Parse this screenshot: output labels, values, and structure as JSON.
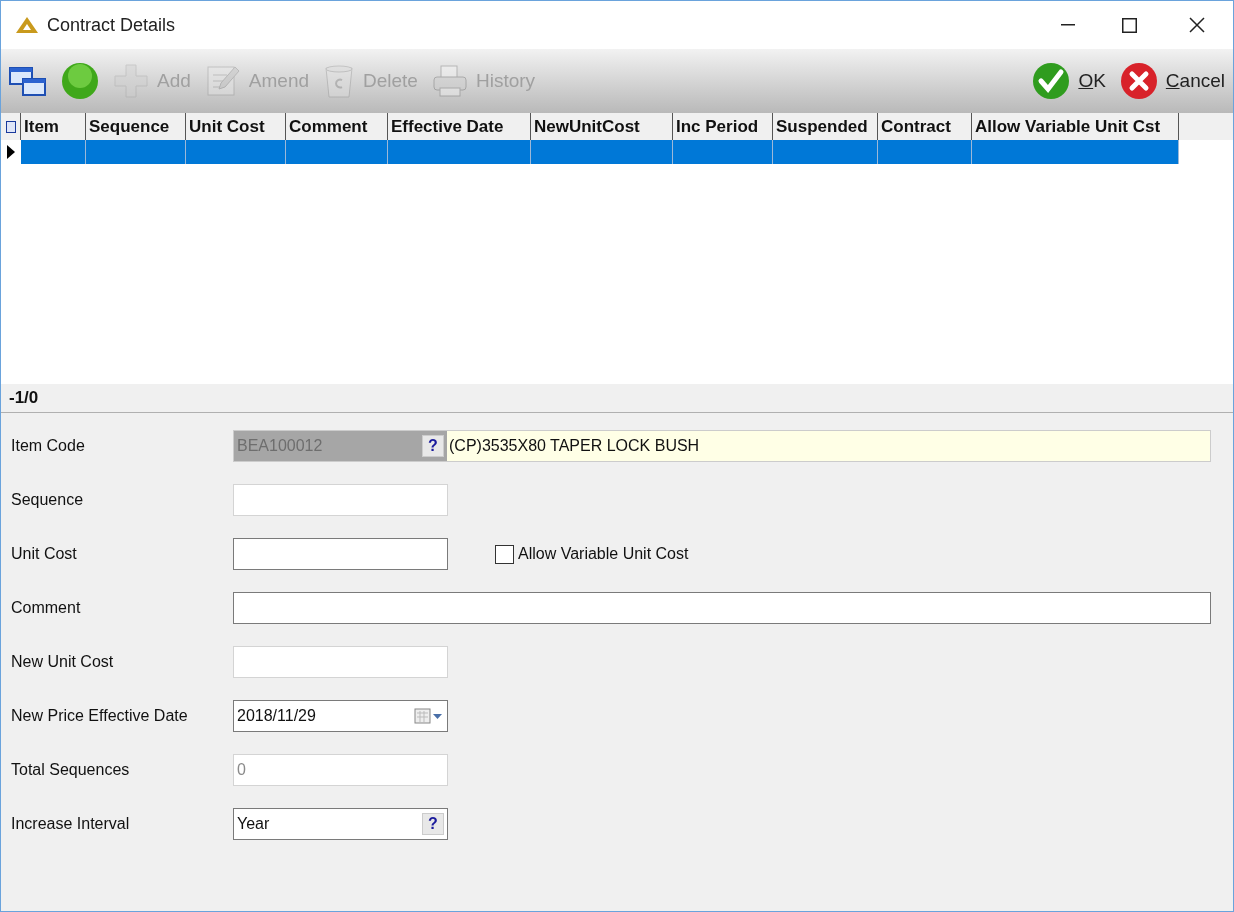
{
  "window": {
    "title": "Contract Details"
  },
  "toolbar": {
    "left": [
      {
        "kind": "windows",
        "disabled": false
      },
      {
        "kind": "go",
        "disabled": false
      },
      {
        "kind": "add",
        "label": "Add",
        "disabled": true
      },
      {
        "kind": "amend",
        "label": "Amend",
        "disabled": true
      },
      {
        "kind": "delete",
        "label": "Delete",
        "disabled": true
      },
      {
        "kind": "history",
        "label": "History",
        "disabled": true
      }
    ],
    "right": [
      {
        "kind": "ok",
        "label": "OK",
        "disabled": false
      },
      {
        "kind": "cancel",
        "label": "Cancel",
        "disabled": false
      }
    ]
  },
  "grid": {
    "columns": [
      "Item",
      "Sequence",
      "Unit Cost",
      "Comment",
      "Effective Date",
      "NewUnitCost",
      "Inc Period",
      "Suspended",
      "Contract",
      "Allow Variable Unit Cst"
    ],
    "rows": [
      {
        "selected": true
      }
    ]
  },
  "record_counter": "-1/0",
  "form": [
    {
      "kind": "lookup",
      "label": "Item Code",
      "value": "BEA100012",
      "help_button": "?",
      "description": "(CP)3535X80 TAPER LOCK BUSH",
      "disabled": true
    },
    {
      "kind": "text",
      "label": "Sequence",
      "disabled": true
    },
    {
      "kind": "text_check",
      "label": "Unit Cost",
      "disabled": false,
      "check_label": "Allow Variable Unit Cost",
      "checked": false
    },
    {
      "kind": "wide",
      "label": "Comment",
      "disabled": false
    },
    {
      "kind": "text",
      "label": "New Unit Cost",
      "disabled": true
    },
    {
      "kind": "date",
      "label": "New Price Effective Date",
      "value": "2018/11/29",
      "disabled": false
    },
    {
      "kind": "text",
      "label": "Total Sequences",
      "value": "0",
      "disabled": true
    },
    {
      "kind": "picker",
      "label": "Increase Interval",
      "value": "Year",
      "help_button": "?",
      "disabled": false
    }
  ]
}
